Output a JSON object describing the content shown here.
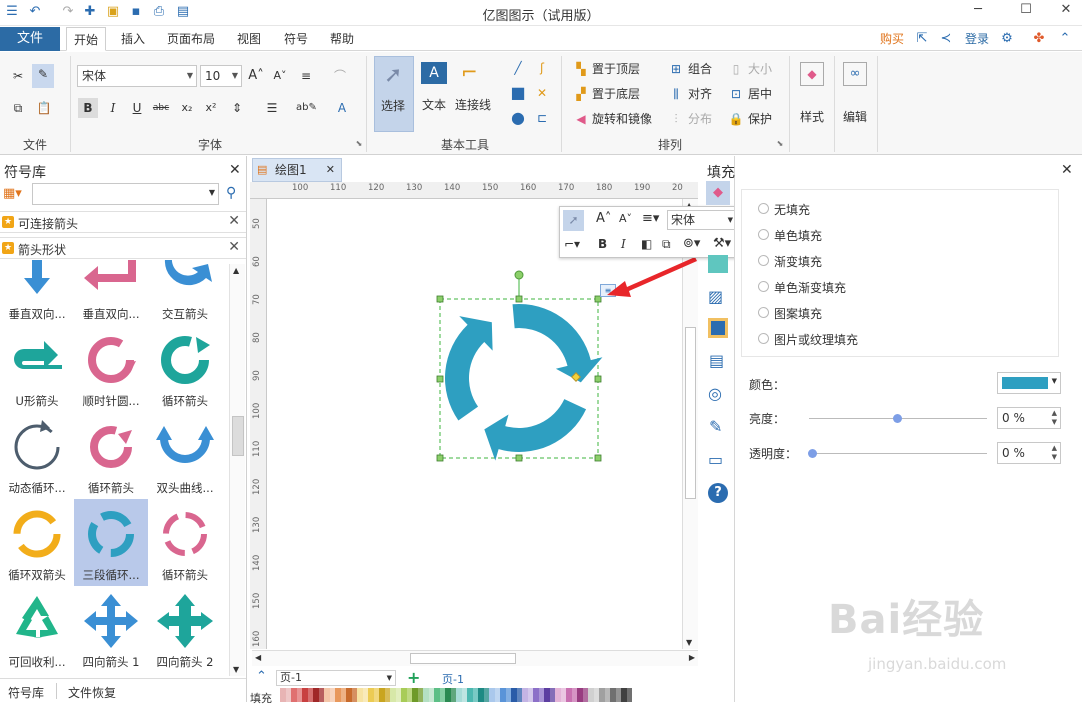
{
  "title_bar": {
    "title": "亿图图示（试用版）"
  },
  "menu": {
    "file": "文件",
    "tabs": [
      "开始",
      "插入",
      "页面布局",
      "视图",
      "符号",
      "帮助"
    ],
    "buy": "购买",
    "login": "登录"
  },
  "ribbon": {
    "groups": {
      "file": "文件",
      "font": "字体",
      "basic_tools": "基本工具",
      "arrange": "排列"
    },
    "font_name": "宋体",
    "font_size": "10",
    "select": "选择",
    "text": "文本",
    "connector": "连接线",
    "bring_front": "置于顶层",
    "send_back": "置于底层",
    "rotate_mirror": "旋转和镜像",
    "group": "组合",
    "align": "对齐",
    "distribute": "分布",
    "size": "大小",
    "center": "居中",
    "protect": "保护",
    "style": "样式",
    "edit": "编辑"
  },
  "left_panel": {
    "title": "符号库",
    "libraries": [
      "可连接箭头",
      "箭头形状"
    ],
    "symbols": [
      {
        "name": "垂直双向..."
      },
      {
        "name": "垂直双向..."
      },
      {
        "name": "交互箭头"
      },
      {
        "name": "U形箭头"
      },
      {
        "name": "顺时针圆..."
      },
      {
        "name": "循环箭头"
      },
      {
        "name": "动态循环..."
      },
      {
        "name": "循环箭头"
      },
      {
        "name": "双头曲线..."
      },
      {
        "name": "循环双箭头"
      },
      {
        "name": "三段循环..."
      },
      {
        "name": "循环箭头"
      },
      {
        "name": "可回收利..."
      },
      {
        "name": "四向箭头 1"
      },
      {
        "name": "四向箭头 2"
      }
    ],
    "footer_tabs": [
      "符号库",
      "文件恢复"
    ]
  },
  "canvas": {
    "tab": "绘图1",
    "ruler_h": [
      "100",
      "110",
      "120",
      "130",
      "140",
      "150",
      "160",
      "170",
      "180",
      "190",
      "20"
    ],
    "ruler_v": [
      "50",
      "60",
      "70",
      "80",
      "90",
      "100",
      "110",
      "120",
      "130",
      "140",
      "150",
      "160"
    ],
    "page_select": "页-1",
    "page_tab": "页-1",
    "fill_label": "填充"
  },
  "float_toolbar": {
    "font": "宋体"
  },
  "fill_panel": {
    "title": "填充",
    "options": [
      "无填充",
      "单色填充",
      "渐变填充",
      "单色渐变填充",
      "图案填充",
      "图片或纹理填充"
    ],
    "color_label": "颜色：",
    "brightness_label": "亮度：",
    "brightness_value": "0 %",
    "transparency_label": "透明度：",
    "transparency_value": "0 %",
    "fill_color": "#2e9fc1"
  },
  "watermark": {
    "text": "Bai经验",
    "url": "jingyan.baidu.com"
  }
}
